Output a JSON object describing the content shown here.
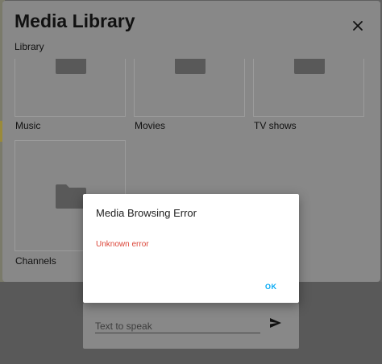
{
  "media_library": {
    "title": "Media Library",
    "subtitle": "Library",
    "close_icon": "close-icon",
    "items": [
      {
        "label": "Music",
        "icon": "folder-icon"
      },
      {
        "label": "Movies",
        "icon": "folder-icon"
      },
      {
        "label": "TV shows",
        "icon": "folder-icon"
      },
      {
        "label": "Channels",
        "icon": "folder-icon"
      }
    ]
  },
  "error_dialog": {
    "title": "Media Browsing Error",
    "message": "Unknown error",
    "ok_label": "OK"
  },
  "tts": {
    "placeholder": "Text to speak",
    "send_icon": "send-icon"
  },
  "colors": {
    "error_text": "#db4437",
    "accent": "#03a9f4",
    "folder": "#595959"
  }
}
